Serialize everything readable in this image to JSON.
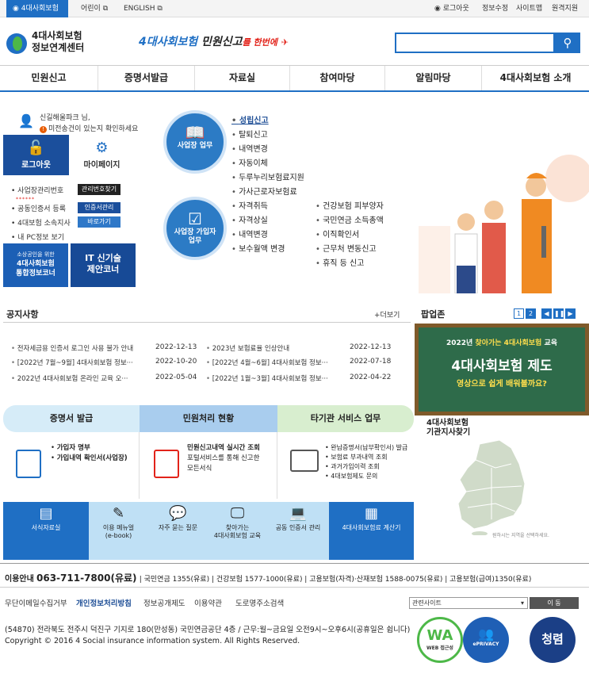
{
  "topbar": {
    "tabs": [
      "4대사회보험",
      "어린이",
      "ENGLISH"
    ],
    "links": [
      "로그아웃",
      "정보수정",
      "사이트맵",
      "원격지원"
    ]
  },
  "header": {
    "logo_line1": "4대사회보험",
    "logo_line2": "정보연계센터",
    "slogan_part1": "4대사회보험",
    "slogan_part2": "민원신고",
    "slogan_part3": "를 한번에",
    "search_placeholder": ""
  },
  "main_nav": [
    "민원신고",
    "증명서발급",
    "자료실",
    "참여마당",
    "알림마당",
    "4대사회보험 소개"
  ],
  "login": {
    "greeting": "신길해울파크 님,",
    "alert": "미전송건이 있는지 확인하세요",
    "logout": "로그아웃",
    "mypage": "마이페이지",
    "rows": [
      {
        "label": "사업장관리번호",
        "button": "관리번호찾기"
      },
      {
        "label": "공동인증서 등록",
        "button": "인증서관리"
      },
      {
        "label": "4대보험 소속지사",
        "button": "바로가기"
      },
      {
        "label": "내 PC정보 보기",
        "button": ""
      }
    ],
    "masked": "******"
  },
  "banners": {
    "b1_small": "소상공인을 위한",
    "b1_line1": "4대사회보험",
    "b1_line2": "통합정보코너",
    "b2_line1": "IT 신기술",
    "b2_line2": "제안코너"
  },
  "services": {
    "workplace_label": "사업장 업무",
    "insured_label_1": "사업장 가입자",
    "insured_label_2": "업무",
    "workplace_menu": [
      "성립신고",
      "탈퇴신고",
      "내역변경",
      "자동이체",
      "두루누리보험료지원",
      "가사근로자보험료"
    ],
    "insured_menu_left": [
      "자격취득",
      "자격상실",
      "내역변경",
      "보수월액 변경"
    ],
    "insured_menu_right": [
      "건강보험 피부양자",
      "국민연금 소득총액",
      "이직확인서",
      "근무처 변동신고",
      "휴직 등 신고"
    ]
  },
  "notice": {
    "title": "공지사항",
    "more": "+더보기",
    "items": [
      {
        "title": "전자세금용 인증서 로그인 사용 불가 안내",
        "date": "2022-12-13"
      },
      {
        "title": "2023년 보험료율 인상안내",
        "date": "2022-12-13"
      },
      {
        "title": "[2022년 7월~9월] 4대사회보험 정보···",
        "date": "2022-10-20"
      },
      {
        "title": "[2022년 4월~6월] 4대사회보험 정보···",
        "date": "2022-07-18"
      },
      {
        "title": "2022년 4대사회보험 온라인 교육 오···",
        "date": "2022-05-04"
      },
      {
        "title": "[2022년 1월~3월] 4대사회보험 정보···",
        "date": "2022-04-22"
      }
    ]
  },
  "popup": {
    "title": "팝업존",
    "pages": [
      "1",
      "2"
    ],
    "line1_a": "2022년",
    "line1_b": "찾아가는 4대사회보험",
    "line1_c": "교육",
    "line2": "4대사회보험 제도",
    "line3": "영상으로 쉽게 배워볼까요?"
  },
  "panels": [
    {
      "head": "증명서 발급",
      "items": [
        "가입자 명부",
        "가입내역 확인서(사업장)"
      ]
    },
    {
      "head": "민원처리 현황",
      "items": [
        "민원신고내역 실시간 조회",
        "포털서비스를 통해 신고한",
        "모든서식"
      ]
    },
    {
      "head": "타기관 서비스 업무",
      "items": [
        "완납증명서(납부확인서) 발급",
        "보험료 부과내역 조회",
        "과거가입이력 조회",
        "4대보험제도 문의"
      ]
    }
  ],
  "quick_menu": [
    {
      "label1": "서식자료실",
      "label2": ""
    },
    {
      "label1": "이용 메뉴얼",
      "label2": "(e-book)"
    },
    {
      "label1": "자주 묻는 질문",
      "label2": ""
    },
    {
      "label1": "찾아가는",
      "label2": "4대사회보험 교육"
    },
    {
      "label1": "공동 인증서 관리",
      "label2": ""
    },
    {
      "label1": "4대사회보험료 계산기",
      "label2": ""
    }
  ],
  "region": {
    "title_1": "4대사회보험",
    "title_2": "기관지사찾기",
    "note": "원하시는 지역을 선택하세요."
  },
  "footer": {
    "contact_label": "이용안내",
    "contact_number": "063-711-7800(유료)",
    "contact_rest": "국민연금 1355(유료)  |  건강보험 1577-1000(유료)  |  고용보험(자격)·산재보험 1588-0075(유료)  |  고용보험(급여)1350(유료)",
    "links": [
      "무단이메일수집거부",
      "개인정보처리방침",
      "정보공개제도",
      "이용약관",
      "도로명주소검색"
    ],
    "related_site": "관련사이트",
    "go": "이 동",
    "address": "(54870) 전라북도 전주시 덕진구 기지로 180(만성동) 국민연금공단 4층 / 근무:월~금요일 오전9시~오후6시(공휴일은 쉽니다)",
    "copyright": "Copyright © 2016 4 Social insurance information system. All Rights Reserved.",
    "cert1": "WA",
    "cert1_sub": "WEB 접근성",
    "cert2": "ePRIVACY",
    "cert3": "청렴"
  },
  "colors": {
    "primary": "#1f6fc4",
    "dark_blue": "#1b4f9c",
    "accent_red": "#e2231a"
  }
}
